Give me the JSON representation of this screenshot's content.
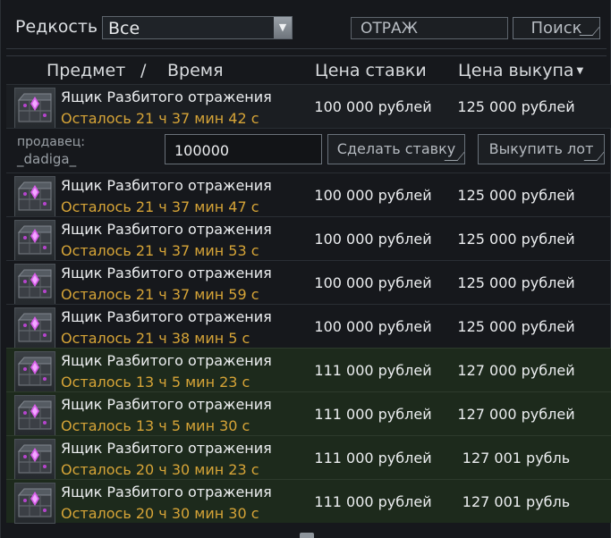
{
  "filter": {
    "rarity_label": "Редкость",
    "rarity_value": "Все",
    "search_value": "ОТРАЖ",
    "search_button": "Поиск"
  },
  "header": {
    "item": "Предмет",
    "separator": "/",
    "time": "Время",
    "bid_price": "Цена ставки",
    "buyout_price": "Цена выкупа"
  },
  "expanded": {
    "seller_label": "продавец:",
    "seller_name": "_dadiga_",
    "bid_value": "100000",
    "bid_button": "Сделать ставку",
    "buyout_button": "Выкупить лот"
  },
  "lots": [
    {
      "name": "Ящик Разбитого отражения",
      "time": "Осталось 21 ч 37 мин 42 с",
      "bid": "100 000 рублей",
      "buyout": "125 000 рублей",
      "highlight": false
    },
    {
      "name": "Ящик Разбитого отражения",
      "time": "Осталось 21 ч 37 мин 47 с",
      "bid": "100 000 рублей",
      "buyout": "125 000 рублей",
      "highlight": false
    },
    {
      "name": "Ящик Разбитого отражения",
      "time": "Осталось 21 ч 37 мин 53 с",
      "bid": "100 000 рублей",
      "buyout": "125 000 рублей",
      "highlight": false
    },
    {
      "name": "Ящик Разбитого отражения",
      "time": "Осталось 21 ч 37 мин 59 с",
      "bid": "100 000 рублей",
      "buyout": "125 000 рублей",
      "highlight": false
    },
    {
      "name": "Ящик Разбитого отражения",
      "time": "Осталось 21 ч 38 мин 5 с",
      "bid": "100 000 рублей",
      "buyout": "125 000 рублей",
      "highlight": false
    },
    {
      "name": "Ящик Разбитого отражения",
      "time": "Осталось 13 ч 5 мин 23 с",
      "bid": "111 000 рублей",
      "buyout": "127 000 рублей",
      "highlight": true
    },
    {
      "name": "Ящик Разбитого отражения",
      "time": "Осталось 13 ч 5 мин 30 с",
      "bid": "111 000 рублей",
      "buyout": "127 000 рублей",
      "highlight": true
    },
    {
      "name": "Ящик Разбитого отражения",
      "time": "Осталось 20 ч 30 мин 23 с",
      "bid": "111 000 рублей",
      "buyout": "127 001 рубль",
      "highlight": true
    },
    {
      "name": "Ящик Разбитого отражения",
      "time": "Осталось 20 ч 30 мин 30 с",
      "bid": "111 000 рублей",
      "buyout": "127 001 рубль",
      "highlight": true
    }
  ],
  "icons": {
    "lot_icon": "purple-crystal-crate-icon",
    "rarity_dropdown": "chevron-down-icon",
    "sort_indicator": "sort-desc-icon"
  },
  "colors": {
    "time_text": "#d6a437",
    "highlight_row": "#1d2a1c",
    "crystal": "#d65be8"
  }
}
